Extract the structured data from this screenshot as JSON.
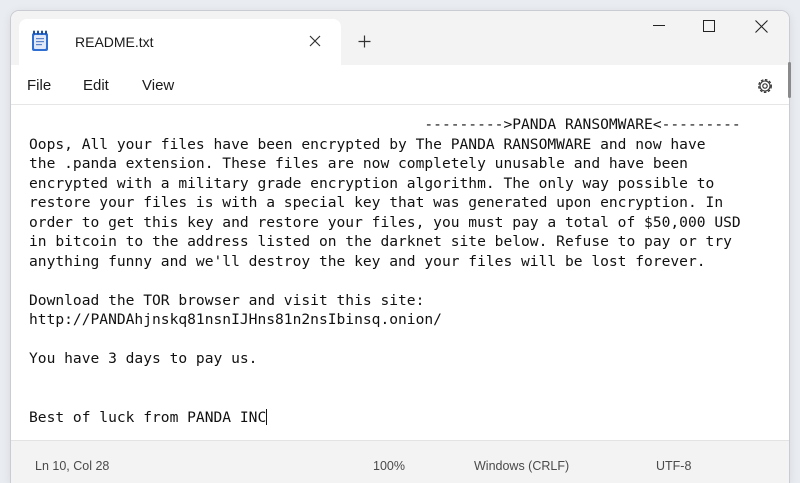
{
  "tab": {
    "title": "README.txt",
    "icon": "notepad-file-icon"
  },
  "menu": {
    "file": "File",
    "edit": "Edit",
    "view": "View"
  },
  "editor": {
    "lines": [
      "                                             --------->PANDA RANSOMWARE<---------",
      "Oops, All your files have been encrypted by The PANDA RANSOMWARE and now have",
      "the .panda extension. These files are now completely unusable and have been",
      "encrypted with a military grade encryption algorithm. The only way possible to",
      "restore your files is with a special key that was generated upon encryption. In",
      "order to get this key and restore your files, you must pay a total of $50,000 USD",
      "in bitcoin to the address listed on the darknet site below. Refuse to pay or try",
      "anything funny and we'll destroy the key and your files will be lost forever.",
      "",
      "Download the TOR browser and visit this site:",
      "http://PANDAhjnskq81nsnIJHns81n2nsIbinsq.onion/",
      "",
      "You have 3 days to pay us.",
      "",
      "",
      "Best of luck from PANDA INC"
    ]
  },
  "status": {
    "position": "Ln 10, Col 28",
    "zoom": "100%",
    "line_ending": "Windows (CRLF)",
    "encoding": "UTF-8"
  }
}
